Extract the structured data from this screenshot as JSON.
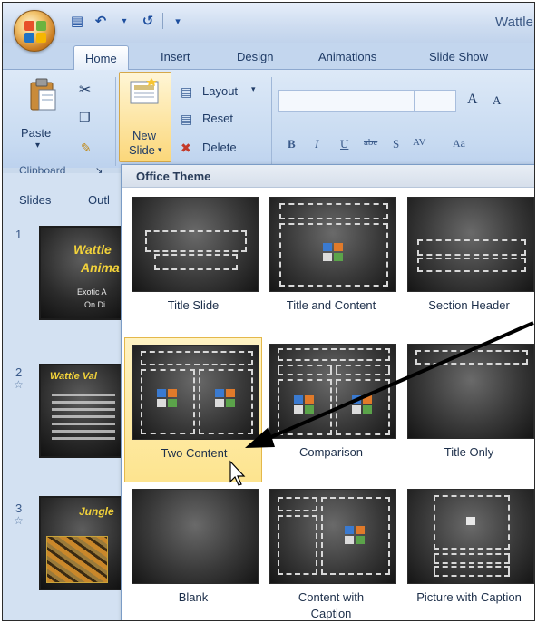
{
  "app": {
    "title": "Wattle"
  },
  "tabs": [
    {
      "label": "Home",
      "active": true
    },
    {
      "label": "Insert"
    },
    {
      "label": "Design"
    },
    {
      "label": "Animations"
    },
    {
      "label": "Slide Show"
    }
  ],
  "ribbon": {
    "paste_label": "Paste",
    "new_slide_label_1": "New",
    "new_slide_label_2": "Slide",
    "layout_label": "Layout",
    "reset_label": "Reset",
    "delete_label": "Delete",
    "clipboard_group": "Clipboard",
    "font_grow": "A",
    "font_shrink": "A",
    "format_buttons": [
      "B",
      "I",
      "U",
      "abe",
      "S",
      "AV",
      "Aa"
    ]
  },
  "left_panel": {
    "tabs": [
      "Slides",
      "Outl"
    ],
    "slides": [
      {
        "number": "1",
        "title_lines": [
          "Wattle",
          "Anima"
        ],
        "subtitle_lines": [
          "Exotic A",
          "On Di"
        ]
      },
      {
        "number": "2",
        "title_lines": [
          "Wattle Val"
        ],
        "has_transition": true
      },
      {
        "number": "3",
        "title_lines": [
          "Jungle"
        ],
        "has_transition": true
      }
    ]
  },
  "gallery": {
    "heading": "Office Theme",
    "layouts": [
      {
        "label": "Title Slide"
      },
      {
        "label": "Title and Content"
      },
      {
        "label": "Section Header"
      },
      {
        "label": "Two Content",
        "selected": true
      },
      {
        "label": "Comparison"
      },
      {
        "label": "Title Only"
      },
      {
        "label": "Blank"
      },
      {
        "label": "Content with Caption"
      },
      {
        "label": "Picture with Caption"
      }
    ]
  },
  "colors": {
    "ribbon_blue": "#c7daf1",
    "selection_yellow": "#fde48f",
    "title_yellow": "#f2d23a"
  }
}
